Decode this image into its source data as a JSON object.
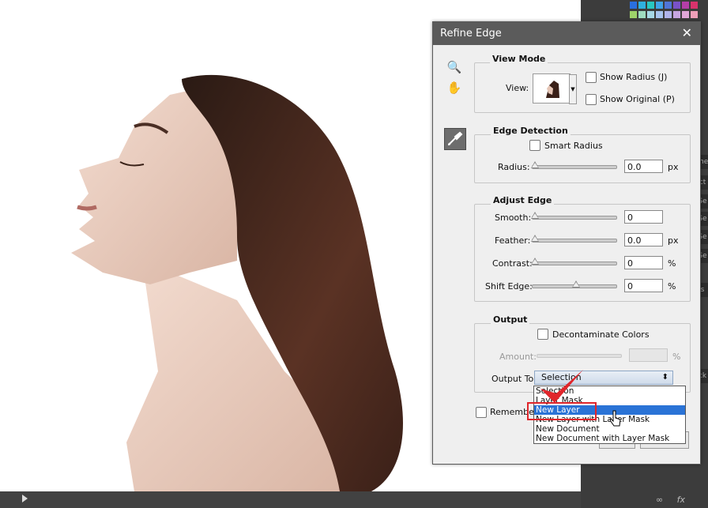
{
  "dialog": {
    "title": "Refine Edge",
    "close_glyph": "✕",
    "view_mode": {
      "heading": "View Mode",
      "view_label": "View:",
      "show_radius": "Show Radius (J)",
      "show_original": "Show Original (P)"
    },
    "edge_detection": {
      "heading": "Edge Detection",
      "smart_radius": "Smart Radius",
      "radius_label": "Radius:",
      "radius_value": "0.0",
      "radius_unit": "px"
    },
    "adjust_edge": {
      "heading": "Adjust Edge",
      "smooth_label": "Smooth:",
      "smooth_value": "0",
      "feather_label": "Feather:",
      "feather_value": "0.0",
      "feather_unit": "px",
      "contrast_label": "Contrast:",
      "contrast_value": "0",
      "contrast_unit": "%",
      "shift_label": "Shift Edge:",
      "shift_value": "0",
      "shift_unit": "%"
    },
    "output": {
      "heading": "Output",
      "decontaminate": "Decontaminate Colors",
      "amount_label": "Amount:",
      "amount_unit": "%",
      "output_to_label": "Output To:",
      "output_to_value": "Selection",
      "remember": "Remember S"
    },
    "dropdown_options": [
      {
        "label": "Selection",
        "selected": false
      },
      {
        "label": "Layer Mask",
        "selected": false
      },
      {
        "label": "New Layer",
        "selected": true
      },
      {
        "label": "New Layer with Layer Mask",
        "selected": false
      },
      {
        "label": "New Document",
        "selected": false
      },
      {
        "label": "New Document with Layer Mask",
        "selected": false
      }
    ]
  },
  "tools": {
    "zoom_icon": "🔍",
    "hand_icon": "✋"
  },
  "side_tabs": [
    "me",
    "ct",
    "Se",
    "Se",
    "Se",
    "Se",
    "s",
    "ck"
  ],
  "bottom_icons": [
    "∞",
    "fx"
  ],
  "colors": {
    "dialog_bg": "#efefef",
    "titlebar": "#5b5b5b",
    "selection_highlight": "#2a73d6",
    "annotation_red": "#e0262b"
  }
}
